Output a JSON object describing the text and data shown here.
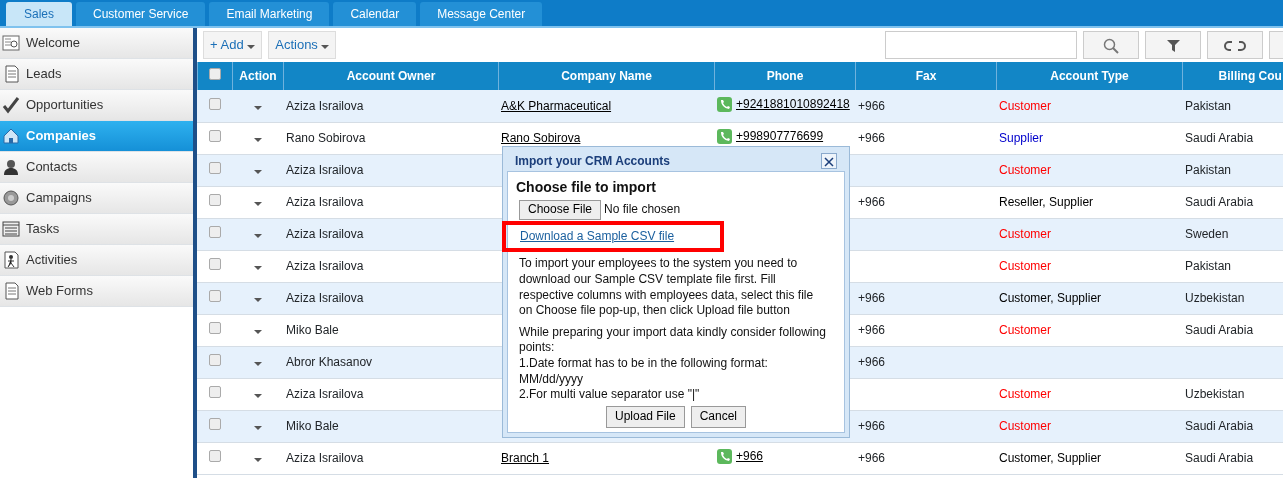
{
  "tabs": [
    {
      "label": "Sales",
      "selected": true
    },
    {
      "label": "Customer Service",
      "selected": false
    },
    {
      "label": "Email Marketing",
      "selected": false
    },
    {
      "label": "Calendar",
      "selected": false
    },
    {
      "label": "Message Center",
      "selected": false
    }
  ],
  "sidebar": {
    "items": [
      {
        "label": "Welcome",
        "selected": false
      },
      {
        "label": "Leads",
        "selected": false
      },
      {
        "label": "Opportunities",
        "selected": false
      },
      {
        "label": "Companies",
        "selected": true
      },
      {
        "label": "Contacts",
        "selected": false
      },
      {
        "label": "Campaigns",
        "selected": false
      },
      {
        "label": "Tasks",
        "selected": false
      },
      {
        "label": "Activities",
        "selected": false
      },
      {
        "label": "Web Forms",
        "selected": false
      }
    ]
  },
  "toolbar": {
    "add": "+ Add",
    "actions": "Actions"
  },
  "table": {
    "all_checked": false,
    "columns": [
      "Action",
      "Account Owner",
      "Company Name",
      "Phone",
      "Fax",
      "Account Type",
      "Billing Cou"
    ],
    "rows": [
      {
        "checked": false,
        "owner": "Aziza Israilova",
        "company": "A&K Pharmaceutical",
        "phone": "+9241881010892418",
        "fax": "+966",
        "account_type": "Customer",
        "kind": "customer",
        "country": "Pakistan"
      },
      {
        "checked": false,
        "owner": "Rano Sobirova",
        "company": "Rano Sobirova",
        "phone": "+998907776699",
        "fax": "+966",
        "account_type": "Supplier",
        "kind": "supplier",
        "country": "Saudi Arabia"
      },
      {
        "checked": false,
        "owner": "Aziza Israilova",
        "company": "",
        "phone": "",
        "fax": "",
        "account_type": "Customer",
        "kind": "customer",
        "country": "Pakistan"
      },
      {
        "checked": false,
        "owner": "Aziza Israilova",
        "company": "",
        "phone": "",
        "fax": "+966",
        "account_type": "Reseller, Supplier",
        "kind": "mixed",
        "country": "Saudi Arabia"
      },
      {
        "checked": false,
        "owner": "Aziza Israilova",
        "company": "",
        "phone": "",
        "fax": "",
        "account_type": "Customer",
        "kind": "customer",
        "country": "Sweden"
      },
      {
        "checked": false,
        "owner": "Aziza Israilova",
        "company": "",
        "phone": "",
        "fax": "",
        "account_type": "Customer",
        "kind": "customer",
        "country": "Pakistan"
      },
      {
        "checked": false,
        "owner": "Aziza Israilova",
        "company": "",
        "phone": "",
        "fax": "+966",
        "account_type": "Customer, Supplier",
        "kind": "mixed",
        "country": "Uzbekistan"
      },
      {
        "checked": false,
        "owner": "Miko Bale",
        "company": "",
        "phone": "",
        "fax": "+966",
        "account_type": "Customer",
        "kind": "customer",
        "country": "Saudi Arabia"
      },
      {
        "checked": false,
        "owner": "Abror Khasanov",
        "company": "",
        "phone": "",
        "fax": "+966",
        "account_type": "",
        "country": ""
      },
      {
        "checked": false,
        "owner": "Aziza Israilova",
        "company": "",
        "phone": "",
        "fax": "",
        "account_type": "Customer",
        "kind": "customer",
        "country": "Uzbekistan"
      },
      {
        "checked": false,
        "owner": "Miko Bale",
        "company": "",
        "phone": "",
        "fax": "+966",
        "account_type": "Customer",
        "kind": "customer",
        "country": "Saudi Arabia"
      },
      {
        "checked": false,
        "owner": "Aziza Israilova",
        "company": "Branch 1",
        "phone": "+966",
        "fax": "+966",
        "account_type": "Customer, Supplier",
        "kind": "mixed",
        "country": "Saudi Arabia"
      }
    ]
  },
  "dialog": {
    "title": "Import your CRM Accounts",
    "heading": "Choose file to import",
    "choose_button": "Choose File",
    "file_status": "No file chosen",
    "sample_link": "Download a Sample CSV file",
    "instructions": "To import your employees to the system you need to download our Sample CSV template file first. Fill respective columns with employees data, select this file on Choose file pop-up, then click Upload file button",
    "notes": [
      "While preparing your import data kindly consider following points:",
      "1.Date format has to be in the following format: MM/dd/yyyy",
      "2.For multi value separator use \"|\""
    ],
    "buttons": [
      "Upload File",
      "Cancel"
    ]
  }
}
